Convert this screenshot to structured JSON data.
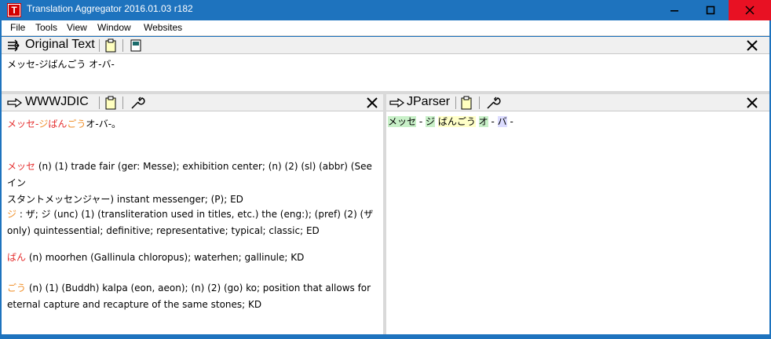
{
  "window": {
    "title": "Translation Aggregator 2016.01.03 r182",
    "icon_letter": "T",
    "controls": {
      "minimize": "—",
      "maximize": "□",
      "close": "✕"
    }
  },
  "menu": [
    "File",
    "Tools",
    "View",
    "Window",
    "Websites"
  ],
  "original": {
    "title": "Original Text",
    "text": "メッセ-ジばんごう オ-バ-"
  },
  "wwwjdic": {
    "title": "WWWJDIC",
    "query_parts": [
      {
        "text": "メッセ-",
        "color": "red"
      },
      {
        "text": "ジ",
        "color": "orange"
      },
      {
        "text": "ばん",
        "color": "red"
      },
      {
        "text": "ごう",
        "color": "orange"
      },
      {
        "text": "オ-バ-。",
        "color": "black"
      }
    ],
    "entries": [
      {
        "head": "メッセ",
        "head_color": "red",
        "line1": " (n) (1) trade fair (ger: Messe); exhibition center; (n) (2) (sl) (abbr) (See イン",
        "line2": "スタントメッセンジャー) instant messenger; (P); ED"
      },
      {
        "head": "ジ",
        "head_color": "orange",
        "line1": " : ザ; ジ (unc) (1) (transliteration used in titles, etc.) the (eng:); (pref) (2) (ザ",
        "line2": "only) quintessential; definitive; representative; typical; classic; ED"
      },
      {
        "head": "ばん",
        "head_color": "red",
        "line1": " (n) moorhen (Gallinula chloropus); waterhen; gallinule; KD",
        "line2": ""
      },
      {
        "head": "ごう",
        "head_color": "orange",
        "line1": " (n) (1) (Buddh) kalpa (eon, aeon); (n) (2) (go) ko; position that allows for",
        "line2": "eternal capture and recapture of the same stones; KD"
      }
    ]
  },
  "jparser": {
    "title": "JParser",
    "tokens": [
      {
        "text": "メッセ",
        "style": "green"
      },
      {
        "text": " - ",
        "style": "plain"
      },
      {
        "text": "ジ",
        "style": "green"
      },
      {
        "text": " ",
        "style": "plain"
      },
      {
        "text": "ばんごう",
        "style": "yellow"
      },
      {
        "text": " ",
        "style": "plain"
      },
      {
        "text": "オ",
        "style": "green"
      },
      {
        "text": " - ",
        "style": "plain"
      },
      {
        "text": "バ",
        "style": "blue"
      },
      {
        "text": " -",
        "style": "plain"
      }
    ]
  },
  "colors": {
    "titlebar": "#1e73be",
    "close_button": "#e81123",
    "highlight_red": "#e53030",
    "highlight_orange": "#f0902b",
    "token_green": "#c8f0c8",
    "token_blue": "#dcdcff",
    "token_yellow": "#ffffc8"
  }
}
